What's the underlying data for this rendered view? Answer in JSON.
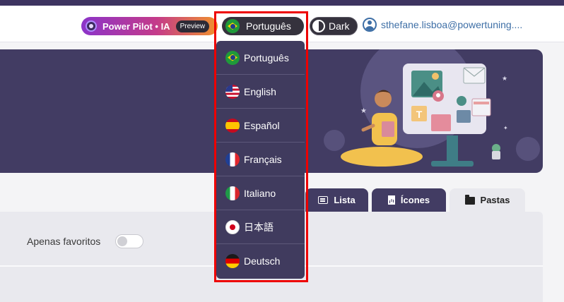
{
  "header": {
    "power_pilot": {
      "label": "Power Pilot • IA",
      "chip": "Preview"
    },
    "language_button": {
      "label": "Português",
      "flag": "flag-br-icon"
    },
    "theme_button": {
      "label": "Dark"
    },
    "user": {
      "email": "sthefane.lisboa@powertuning...."
    }
  },
  "language_menu": {
    "items": [
      {
        "label": "Português",
        "flag": "br"
      },
      {
        "label": "English",
        "flag": "us"
      },
      {
        "label": "Español",
        "flag": "es"
      },
      {
        "label": "Français",
        "flag": "fr"
      },
      {
        "label": "Italiano",
        "flag": "it"
      },
      {
        "label": "日本語",
        "flag": "jp"
      },
      {
        "label": "Deutsch",
        "flag": "de"
      }
    ]
  },
  "tabs": [
    {
      "label": "Lista",
      "icon": "list-icon"
    },
    {
      "label": "Ícones",
      "icon": "document-chart-icon"
    },
    {
      "label": "Pastas",
      "icon": "folder-icon"
    }
  ],
  "filters": {
    "favorites_label": "Apenas favoritos",
    "favorites_enabled": false
  },
  "colors": {
    "accent": "#423c63",
    "highlight": "#ee0000",
    "header_bg": "#ffffff",
    "content_bg": "#e9e9ee"
  }
}
